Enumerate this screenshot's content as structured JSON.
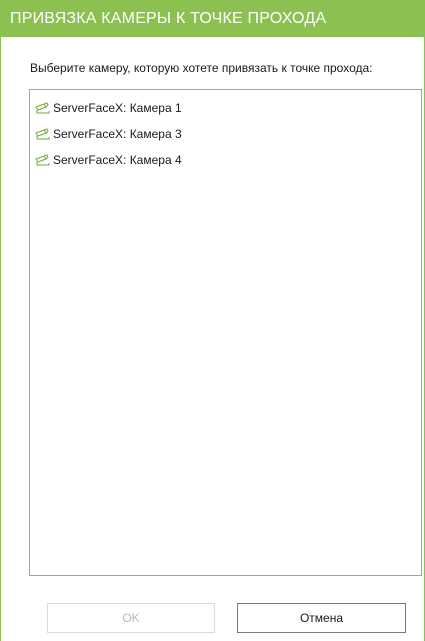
{
  "dialog": {
    "title": "ПРИВЯЗКА КАМЕРЫ К ТОЧКЕ ПРОХОДА",
    "prompt": "Выберите камеру, которую хотете привязать к точке прохода:"
  },
  "cameras": [
    {
      "label": "ServerFaceX: Камера 1",
      "icon": "camera-icon"
    },
    {
      "label": "ServerFaceX: Камера 3",
      "icon": "camera-icon"
    },
    {
      "label": "ServerFaceX: Камера 4",
      "icon": "camera-icon"
    }
  ],
  "buttons": {
    "ok_label": "OK",
    "ok_enabled": false,
    "cancel_label": "Отмена"
  },
  "colors": {
    "accent": "#8cc152",
    "disabled_text": "#b8b8b8"
  }
}
